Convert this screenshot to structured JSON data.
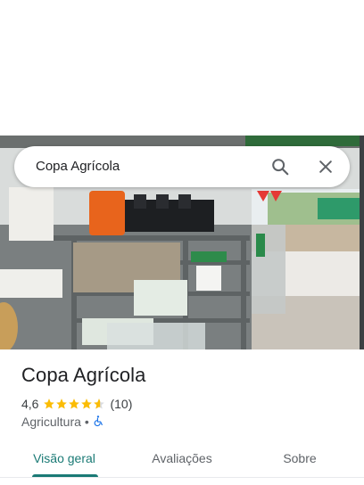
{
  "search": {
    "query": "Copa Agrícola",
    "search_icon": "search-icon",
    "close_icon": "close-icon"
  },
  "place": {
    "name": "Copa Agrícola",
    "rating": "4,6",
    "stars": 4.6,
    "review_count": "(10)",
    "category": "Agricultura",
    "separator": "•",
    "accessibility_icon": "wheelchair-icon"
  },
  "tabs": [
    {
      "label": "Visão geral",
      "active": true
    },
    {
      "label": "Avaliações",
      "active": false
    },
    {
      "label": "Sobre",
      "active": false
    }
  ],
  "colors": {
    "accent": "#1a7a75",
    "star": "#fbbc04",
    "accessibility": "#1a73e8"
  }
}
